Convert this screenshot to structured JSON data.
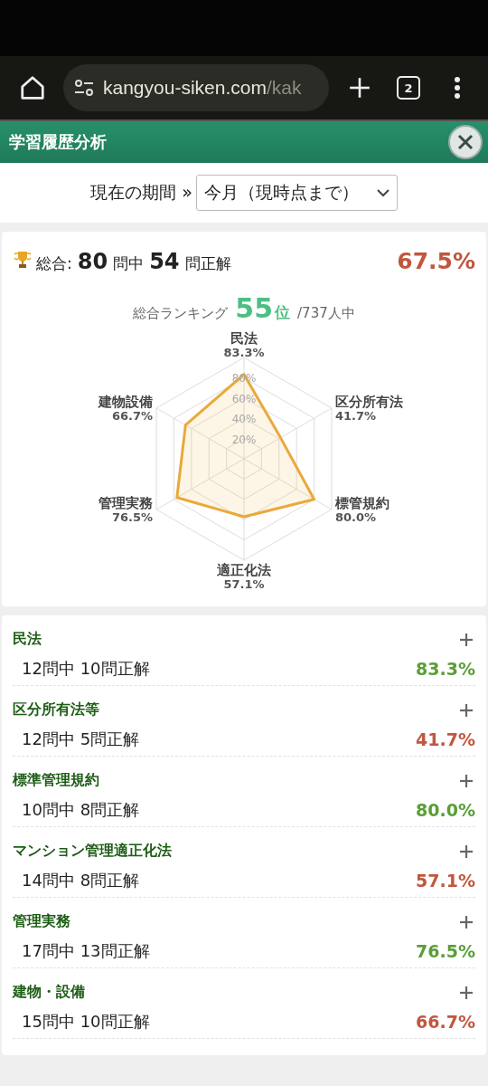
{
  "browser": {
    "url_host": "kangyou-siken.com",
    "url_path": "/kak",
    "tab_count": "2"
  },
  "header": {
    "title": "学習履歴分析"
  },
  "period": {
    "label": "現在の期間 »",
    "value": "今月（現時点まで）"
  },
  "summary": {
    "prefix": "総合:",
    "total": "80",
    "total_unit": "問中",
    "correct": "54",
    "correct_unit": "問正解",
    "percent": "67.5%",
    "passed": false,
    "ranking_label": "総合ランキング",
    "rank": "55",
    "rank_unit": "位",
    "rank_total": "/737人中",
    "axis_values": [
      "83.3%",
      "41.7%",
      "80.0%",
      "57.1%",
      "76.5%",
      "66.7%"
    ],
    "chart_data": {
      "type": "radar",
      "categories": [
        "民法",
        "区分所有法",
        "標管規約",
        "適正化法",
        "管理実務",
        "建物設備"
      ],
      "values": [
        83.3,
        41.7,
        80.0,
        57.1,
        76.5,
        66.7
      ],
      "ylim": [
        0,
        100
      ],
      "yticks": [
        {
          "value": 80,
          "label": "80%"
        },
        {
          "value": 60,
          "label": "60%"
        },
        {
          "value": 40,
          "label": "40%"
        },
        {
          "value": 20,
          "label": "20%"
        }
      ]
    }
  },
  "categories": [
    {
      "title": "民法",
      "expanded": false,
      "detail": "12問中 10問正解",
      "percent": "83.3%",
      "passed": true
    },
    {
      "title": "区分所有法等",
      "expanded": false,
      "detail": "12問中 5問正解",
      "percent": "41.7%",
      "passed": false
    },
    {
      "title": "標準管理規約",
      "expanded": false,
      "detail": "10問中 8問正解",
      "percent": "80.0%",
      "passed": true
    },
    {
      "title": "マンション管理適正化法",
      "expanded": false,
      "detail": "14問中 8問正解",
      "percent": "57.1%",
      "passed": false
    },
    {
      "title": "管理実務",
      "expanded": false,
      "detail": "17問中 13問正解",
      "percent": "76.5%",
      "passed": true
    },
    {
      "title": "建物・設備",
      "expanded": false,
      "detail": "15問中 10問正解",
      "percent": "66.7%",
      "passed": false
    }
  ]
}
